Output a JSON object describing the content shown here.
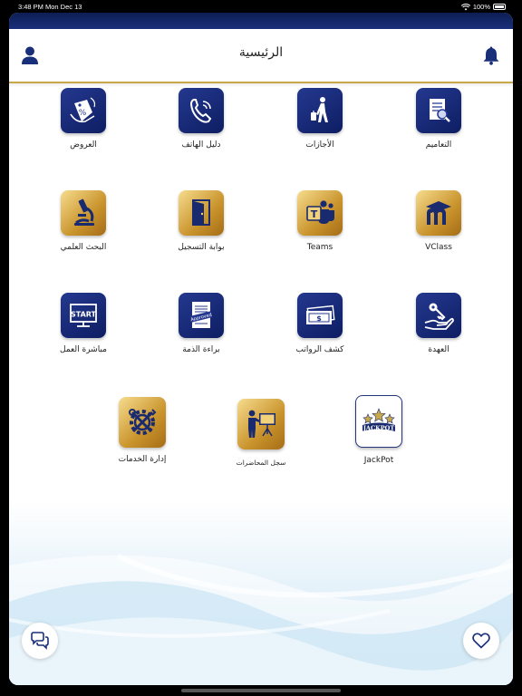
{
  "status": {
    "time": "3:48 PM",
    "date": "Mon Dec 13",
    "battery": "100%"
  },
  "header": {
    "title": "الرئيسية"
  },
  "tiles": [
    {
      "label": "التعاميم",
      "icon": "document-search-icon"
    },
    {
      "label": "الأجازات",
      "icon": "traveler-icon"
    },
    {
      "label": "دليل الهاتف",
      "icon": "phone-icon"
    },
    {
      "label": "العروض",
      "icon": "discount-tag-icon"
    },
    {
      "label": "VClass",
      "icon": "vclass-logo-icon"
    },
    {
      "label": "Teams",
      "icon": "teams-logo-icon"
    },
    {
      "label": "بوابة التسجيل",
      "icon": "door-icon"
    },
    {
      "label": "البحث العلمي",
      "icon": "microscope-icon"
    },
    {
      "label": "العهدة",
      "icon": "key-hand-icon"
    },
    {
      "label": "كشف الرواتب",
      "icon": "money-bill-icon"
    },
    {
      "label": "براءة الذمة",
      "icon": "approved-document-icon"
    },
    {
      "label": "مباشرة العمل",
      "icon": "start-screen-icon"
    },
    {
      "label": "JackPot",
      "icon": "jackpot-stars-icon"
    },
    {
      "label": "سجل المحاضرات",
      "icon": "lecturer-board-icon"
    },
    {
      "label": "إدارة الخدمات",
      "icon": "tools-gear-icon"
    }
  ],
  "icon_text": {
    "start": "START",
    "approved": "Approved",
    "jackpot": "JACKPOT",
    "dollar": "$"
  },
  "colors": {
    "navy": "#1a2f7a",
    "gold": "#c9a84a"
  }
}
